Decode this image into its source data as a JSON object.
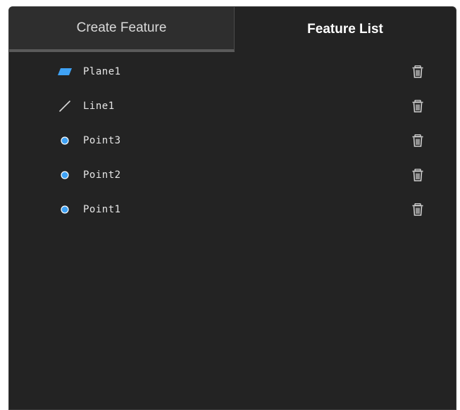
{
  "tabs": {
    "create_label": "Create Feature",
    "list_label": "Feature List",
    "active": "Feature List"
  },
  "features": [
    {
      "label": "Plane1",
      "icon": "plane-icon"
    },
    {
      "label": "Line1",
      "icon": "line-icon"
    },
    {
      "label": "Point3",
      "icon": "point-icon"
    },
    {
      "label": "Point2",
      "icon": "point-icon"
    },
    {
      "label": "Point1",
      "icon": "point-icon"
    }
  ],
  "colors": {
    "panel_bg": "#232323",
    "tab_inactive_bg": "#2e2e2e",
    "accent_blue": "#3fa2f5",
    "text": "#e6e6e6"
  }
}
